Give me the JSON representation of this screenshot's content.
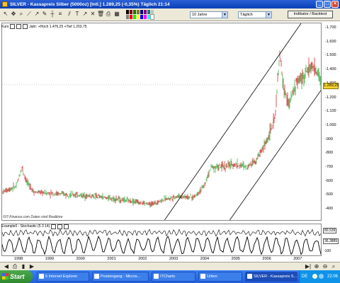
{
  "window": {
    "title": "SILVER - Kassapreis Silber (5000oz) [Intl.]   1.289,25 (-0,35%)   Täglich  21:14"
  },
  "toolbar": {
    "period_select": "10 Jahre",
    "interval_select": "Täglich",
    "indicator_button": "Indikator / Backtest"
  },
  "chart": {
    "panel_label": "Kurs",
    "panel_info": "Jahr: +Hoch 1.476,25 +Tief 1.203,75",
    "source_note": "©IT-Finance.com  Daten sind Realtime",
    "last_price_tag": "1.289,25",
    "y_ticks": [
      "1.700",
      "1.600",
      "1.500",
      "1.400",
      "1.300",
      "1.200",
      "1.100",
      "1.000",
      "900",
      "800",
      "700",
      "600",
      "500",
      "400"
    ],
    "x_ticks": [
      "1998",
      "1999",
      "2000",
      "2001",
      "2002",
      "2003",
      "2004",
      "2005",
      "2006",
      "2007"
    ]
  },
  "stochastic": {
    "label": "Example0 - Stochastic (5 3 14)",
    "value_top": "80,539",
    "value_bottom": "36,3889",
    "axis_low": "-100"
  },
  "taskbar": {
    "start_label": "Start",
    "items": [
      "6 Internet Explorer",
      "Posteingang - Micros...",
      "ITCharts",
      "Uriten",
      "SILVER - Kassapreis S..."
    ],
    "tray_lang": "DE",
    "clock": "22:06"
  },
  "colors": {
    "titlebar": "#0a3fb5",
    "taskbar": "#245edc",
    "start_button": "#2f8a2f",
    "candle_up": "#3cb043",
    "candle_down": "#d03030",
    "price_tag": "#f5d230"
  },
  "icons": [
    "pointer-icon",
    "zoom-icon",
    "pen-icon",
    "line-icon",
    "trend-icon",
    "fib-icon",
    "text-icon",
    "delete-icon",
    "print-icon",
    "color-palette-icon"
  ]
}
